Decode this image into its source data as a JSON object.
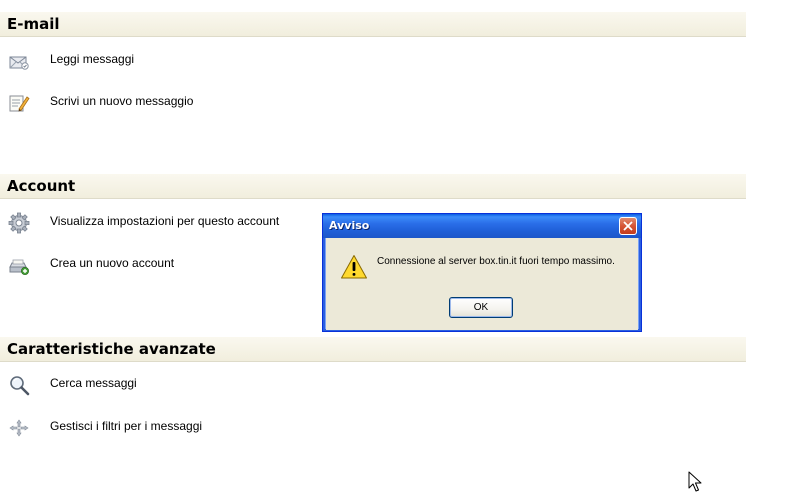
{
  "sections": {
    "email": {
      "title": "E-mail",
      "items": [
        {
          "label": "Leggi messaggi",
          "icon": "read-mail-icon"
        },
        {
          "label": "Scrivi un nuovo messaggio",
          "icon": "compose-message-icon"
        }
      ]
    },
    "account": {
      "title": "Account",
      "items": [
        {
          "label": "Visualizza impostazioni per questo account",
          "icon": "settings-gear-icon"
        },
        {
          "label": "Crea un nuovo account",
          "icon": "new-account-icon"
        }
      ]
    },
    "advanced": {
      "title": "Caratteristiche avanzate",
      "items": [
        {
          "label": "Cerca messaggi",
          "icon": "magnifier-icon"
        },
        {
          "label": "Gestisci i filtri per i messaggi",
          "icon": "filter-arrows-icon"
        }
      ]
    }
  },
  "dialog": {
    "title": "Avviso",
    "message": "Connessione al server box.tin.it fuori tempo massimo.",
    "ok_label": "OK",
    "icon": "warning-icon"
  },
  "colors": {
    "header_bg": "#f1eedd",
    "dialog_title_blue": "#2a6ee8",
    "dialog_bg": "#ece9d8",
    "close_red": "#d65536"
  }
}
